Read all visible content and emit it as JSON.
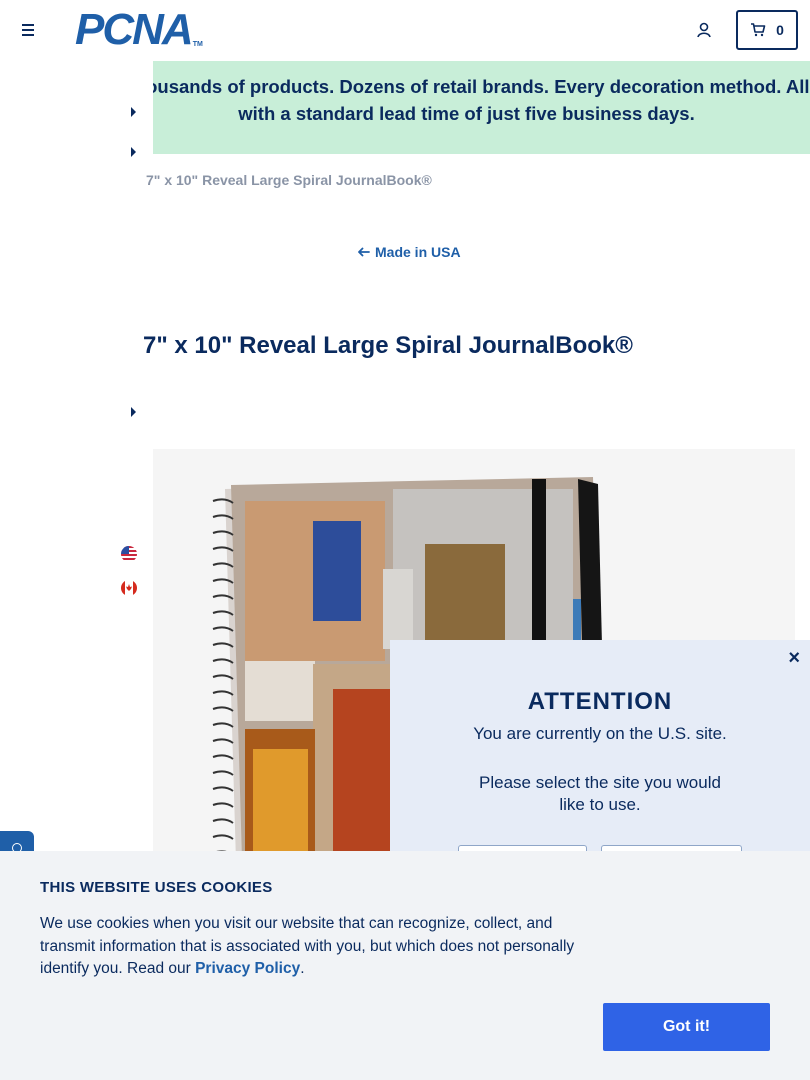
{
  "header": {
    "logo_text": "PCNA",
    "logo_tm": "TM",
    "cart_count": "0"
  },
  "promo": {
    "text": "Thousands of products. Dozens of retail brands. Every decoration method. All with a standard lead time of just five business days."
  },
  "breadcrumb": {
    "current": "7\" x 10\" Reveal Large Spiral JournalBook®"
  },
  "back_link": {
    "label": "Made in USA"
  },
  "product": {
    "title": "7\" x 10\" Reveal Large Spiral JournalBook®"
  },
  "country_flags": [
    {
      "icon": "us-flag-icon"
    },
    {
      "icon": "canada-flag-icon"
    }
  ],
  "attention_modal": {
    "close": "×",
    "title": "ATTENTION",
    "message": "You are currently on the U.S. site.",
    "prompt": "Please select the site you would like to use."
  },
  "cookie_banner": {
    "title": "THIS WEBSITE USES COOKIES",
    "text_before": "We use cookies when you visit our website that can recognize, collect, and transmit information that is associated with you, but which does not personally identify you. Read our ",
    "link": "Privacy Policy",
    "text_after": ".",
    "button": "Got it!"
  },
  "colors": {
    "navy": "#0a2a5e",
    "brand_blue": "#1f5fa8",
    "promo_bg": "#c8eed8",
    "cookie_button": "#2f63e6"
  }
}
